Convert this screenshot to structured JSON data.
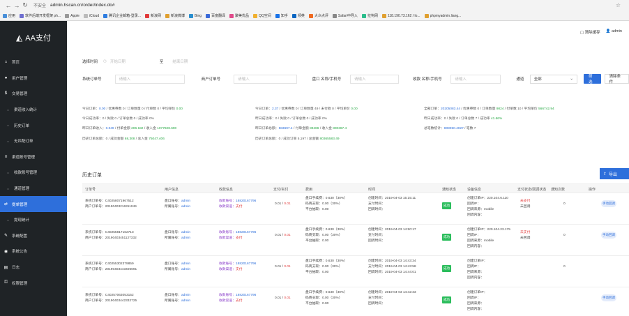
{
  "browser": {
    "insecure_label": "不安全",
    "url": "admin.hscan.cn/order/index.do#",
    "bookmarks": [
      {
        "label": "应用",
        "color": "#4a90d9"
      },
      {
        "label": "软件后端开发框架 ph...",
        "color": "#6f6fd0"
      },
      {
        "label": "Apple",
        "color": "#999999"
      },
      {
        "label": "iCloud",
        "color": "#bbbbbb"
      },
      {
        "label": "腾讯企业邮箱-登录...",
        "color": "#2e7de0"
      },
      {
        "label": "新浪网",
        "color": "#e03a3a"
      },
      {
        "label": "新浪微博",
        "color": "#e0a030"
      },
      {
        "label": "Bing",
        "color": "#2a8fcf"
      },
      {
        "label": "百度翻译",
        "color": "#3a6ad8"
      },
      {
        "label": "聚美优品",
        "color": "#e04a8a"
      },
      {
        "label": "QQ空间",
        "color": "#f0b030"
      },
      {
        "label": "知乎",
        "color": "#1a73e8"
      },
      {
        "label": "领英",
        "color": "#0a66c2"
      },
      {
        "label": "大众点评",
        "color": "#f06a20"
      },
      {
        "label": "Safari中导入",
        "color": "#888888"
      },
      {
        "label": "拉钩网",
        "color": "#2bbd8c"
      },
      {
        "label": "118.190.73.162 / lo...",
        "color": "#e0a030"
      },
      {
        "label": "phpmyadmin.liang...",
        "color": "#e0a030"
      }
    ]
  },
  "sidebar": {
    "brand": "AA支付",
    "items": [
      {
        "label": "首页",
        "icon": "home-icon",
        "glyph": "⌂"
      },
      {
        "label": "用户管理",
        "icon": "user-icon",
        "glyph": "●"
      },
      {
        "label": "交易管理",
        "icon": "dollar-icon",
        "glyph": "$"
      },
      {
        "label": "渠道收入统计",
        "icon": "",
        "glyph": ""
      },
      {
        "label": "历史订单",
        "icon": "",
        "glyph": ""
      },
      {
        "label": "无匹配订单",
        "icon": "",
        "glyph": ""
      },
      {
        "label": "渠道账号管理",
        "icon": "list-icon",
        "glyph": "≡"
      },
      {
        "label": "收款账号管理",
        "icon": "",
        "glyph": ""
      },
      {
        "label": "通道管理",
        "icon": "",
        "glyph": ""
      },
      {
        "label": "提单管理",
        "icon": "transfer-icon",
        "glyph": "⇄"
      },
      {
        "label": "提现统计",
        "icon": "",
        "glyph": ""
      },
      {
        "label": "系统配置",
        "icon": "wrench-icon",
        "glyph": "✎"
      },
      {
        "label": "系统公告",
        "icon": "bell-icon",
        "glyph": "◉"
      },
      {
        "label": "日志",
        "icon": "log-icon",
        "glyph": "▤"
      },
      {
        "label": "权限管理",
        "icon": "lock-icon",
        "glyph": "⚿"
      }
    ]
  },
  "topbar": {
    "clear_cache": "清除缓存",
    "user": "admin"
  },
  "filters": {
    "date_label": "选择时间",
    "start_placeholder": "开始日期",
    "to": "至",
    "end_placeholder": "结束日期",
    "system_order_label": "系统订单号",
    "merchant_order_label": "商户订单号",
    "platform_label": "盘口 名称/手机号",
    "payee_label": "收款 名称/手机号",
    "input_placeholder": "请输入",
    "channel_label": "通道",
    "channel_value": "全部",
    "filter_button": "筛选",
    "clear_button": "清除条件"
  },
  "stats": {
    "col1": [
      {
        "text": "今日订单：",
        "v": "0.00",
        "rest": " / 优惠券数 0 / 订单数量 0 / 付单数 0 / 平均单价 ",
        "g": "0.00"
      },
      {
        "text": "今日成功率：",
        "v": "",
        "rest": "0 / 失败 0 / 订单总数 0 / 成功率 0%",
        "g": ""
      },
      {
        "text": "昨日订单收入：",
        "v": "0.049",
        "rest": " / 付单金额 ",
        "g": "206.182",
        "rest2": " / 收入金 ",
        "g2": "1077828.690"
      },
      {
        "text": "历史订单总额：",
        "v": "",
        "rest": "0 / 成功金额 ",
        "g": "68,308",
        "rest2": " / 总入金 ",
        "g2": "75047.406"
      }
    ],
    "col2": [
      {
        "text": "今日订单：",
        "v": "2.37",
        "rest": " / 优惠券数 0 / 订单数量 49 / 未付款 0 / 平均单价 ",
        "g": "0.00"
      },
      {
        "text": "昨日成功率：",
        "v": "",
        "rest": "0 / 失败 0 / 订单总数 0 / 成功率 0%",
        "g": ""
      },
      {
        "text": "昨日订单总额：",
        "v": "583697.4",
        "rest": " / 付单金额 ",
        "g": "89486",
        "rest2": " / 收入金 ",
        "g2": "800367.4"
      },
      {
        "text": "历史订单总额：",
        "v": "",
        "rest": "0 / 成功订单 5,197 / 总金额 ",
        "g": "80365583.49",
        "rest2": "",
        "g2": ""
      }
    ],
    "col3": [
      {
        "text": "全部订单：",
        "v": "20205083.44",
        "rest": " / 优惠券数 0 / 订单数量 ",
        "g": "9824",
        "rest2": " / 付单数 10 / 平均单价 ",
        "g2": "566742.94"
      },
      {
        "text": "昨日成功率：",
        "v": "",
        "rest": "0 / 失败 0 / 订单总数 7 / 成功率 ",
        "g": "41.66%",
        "rest2": "",
        "g2": ""
      },
      {
        "text": "总笔数统计：",
        "v": "808050.4027",
        "rest": " / 笔数 7",
        "g": "",
        "rest2": "",
        "g2": ""
      }
    ]
  },
  "orders": {
    "title": "历史订单",
    "export_label": "导出",
    "headers": [
      "订单号",
      "用户信息",
      "收款信息",
      "支付/实付",
      "费用",
      "时间",
      "通知状态",
      "设备信息",
      "支付状态/回调状态",
      "通知次数",
      "操作"
    ],
    "rows": [
      {
        "sys_no": "C40258071967512",
        "mer_no": "20190403216311049",
        "pan": "admin",
        "xie": "admin",
        "recv_acct": "18820167796",
        "recv_ch": "支付",
        "amount": "0.01",
        "paid": "0.01",
        "fee1": "0.630（30%）",
        "fee2": "0.00（30%）",
        "fee3": "0.00",
        "t1": "2019-04-03 15:15:11",
        "t2": "",
        "t3": "",
        "status_badge": "成功",
        "ip": "220.104.6.110",
        "dev": "",
        "src": "mobile",
        "ext": "",
        "pay_status": "未支付",
        "cb_status": "未回调",
        "notify_count": "0",
        "action": "手动回调"
      },
      {
        "sys_no": "C40255817162713",
        "mer_no": "20190403451127332",
        "pan": "admin",
        "xie": "admin",
        "recv_acct": "18820167796",
        "recv_ch": "支付",
        "amount": "0.01",
        "paid": "0.01",
        "fee1": "0.630（30%）",
        "fee2": "0.00（30%）",
        "fee3": "0.00",
        "t1": "2019-04-03 14:50:17",
        "t2": "",
        "t3": "",
        "status_badge": "成功",
        "ip": "220.104.23.175",
        "dev": "",
        "src": "mobile",
        "ext": "",
        "pay_status": "未支付",
        "cb_status": "未回调",
        "notify_count": "0",
        "action": "手动回调"
      },
      {
        "sys_no": "C40255302379859",
        "mer_no": "20190403443406691",
        "pan": "admin",
        "xie": "admin",
        "recv_acct": "18820167796",
        "recv_ch": "支付",
        "amount": "0.01",
        "paid": "0.01",
        "fee1": "0.630（30%）",
        "fee2": "0.00（30%）",
        "fee3": "0.00",
        "t1": "2019-04-03 14:43:34",
        "t2": "2019-04-03 14:43:58",
        "t3": "2019-04-03 14:44:01",
        "status_badge": "成功",
        "ip": "",
        "dev": "",
        "src": "",
        "ext": "",
        "pay_status": "",
        "cb_status": "",
        "notify_count": "0",
        "action": ""
      },
      {
        "sys_no": "C40257063053152",
        "mer_no": "20190403442332725",
        "pan": "admin",
        "xie": "admin",
        "recv_acct": "18820167796",
        "recv_ch": "支付",
        "amount": "0.01",
        "paid": "0.01",
        "fee1": "0.630（30%）",
        "fee2": "0.00（30%）",
        "fee3": "0.00",
        "t1": "2019-04-03 14:42:33",
        "t2": "",
        "t3": "",
        "status_badge": "成功",
        "ip": "",
        "dev": "",
        "src": "",
        "ext": "",
        "pay_status": "",
        "cb_status": "",
        "notify_count": "",
        "action": "手动回调"
      }
    ],
    "labels": {
      "sys": "系统订单号：",
      "mer": "商户订单号：",
      "pan": "盘口账号：",
      "xie": "所属账号：",
      "recv_acct": "收款账号：",
      "recv_ch": "收款渠道：",
      "fee1": "盘口手续费：",
      "fee2": "码商支取：",
      "fee3": "平台抽取：",
      "t1": "创建时间：",
      "t2": "支付时间：",
      "t3": "回调时间：",
      "ip": "创建订单IP：",
      "dev": "回调IP：",
      "src": "回调来源：",
      "ext": "回调内容："
    }
  }
}
